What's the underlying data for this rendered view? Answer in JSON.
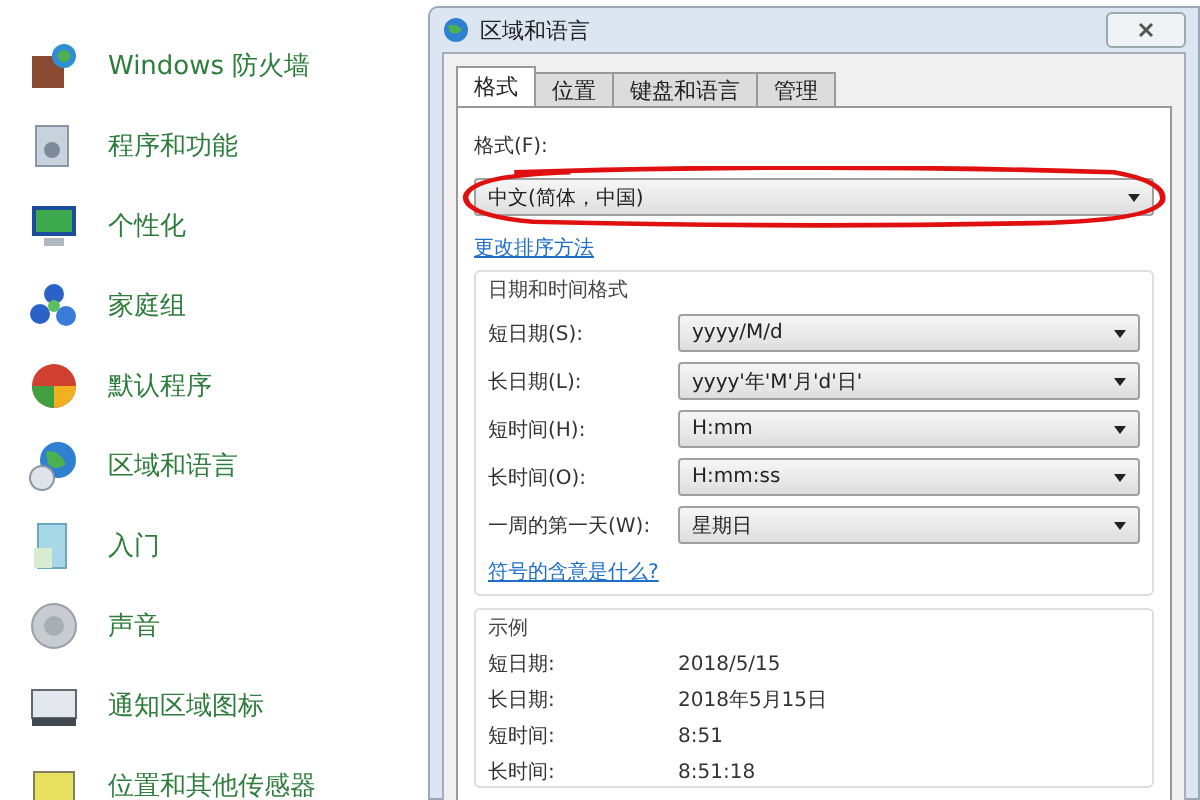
{
  "control_panel": {
    "items": [
      {
        "label": "Windows 防火墙"
      },
      {
        "label": "程序和功能"
      },
      {
        "label": "个性化"
      },
      {
        "label": "家庭组"
      },
      {
        "label": "默认程序"
      },
      {
        "label": "区域和语言"
      },
      {
        "label": "入门"
      },
      {
        "label": "声音"
      },
      {
        "label": "通知区域图标"
      },
      {
        "label": "位置和其他传感器"
      }
    ]
  },
  "dialog": {
    "title": "区域和语言",
    "tabs": [
      {
        "label": "格式",
        "selected": true
      },
      {
        "label": "位置",
        "selected": false
      },
      {
        "label": "键盘和语言",
        "selected": false
      },
      {
        "label": "管理",
        "selected": false
      }
    ],
    "format": {
      "label": "格式(F):",
      "value": "中文(简体，中国)"
    },
    "sort_link": "更改排序方法",
    "date_time_group": {
      "title": "日期和时间格式",
      "rows": [
        {
          "label": "短日期(S):",
          "value": "yyyy/M/d"
        },
        {
          "label": "长日期(L):",
          "value": "yyyy'年'M'月'd'日'"
        },
        {
          "label": "短时间(H):",
          "value": "H:mm"
        },
        {
          "label": "长时间(O):",
          "value": "H:mm:ss"
        },
        {
          "label": "一周的第一天(W):",
          "value": "星期日"
        }
      ],
      "link": "符号的含意是什么?"
    },
    "example_group": {
      "title": "示例",
      "rows": [
        {
          "label": "短日期:",
          "value": "2018/5/15"
        },
        {
          "label": "长日期:",
          "value": "2018年5月15日"
        },
        {
          "label": "短时间:",
          "value": "8:51"
        },
        {
          "label": "长时间:",
          "value": "8:51:18"
        }
      ]
    }
  }
}
